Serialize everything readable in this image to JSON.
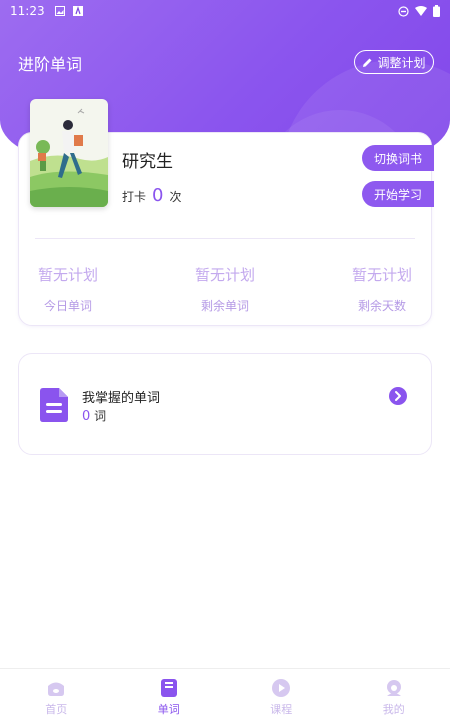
{
  "status_bar": {
    "time": "11:23"
  },
  "header": {
    "title": "进阶单词",
    "adjust_plan_label": "调整计划"
  },
  "book": {
    "name": "研究生",
    "checkin_prefix": "打卡",
    "checkin_count": "0",
    "checkin_suffix": "次",
    "switch_label": "切换词书",
    "start_label": "开始学习"
  },
  "stats": [
    {
      "value": "暂无计划",
      "label": "今日单词"
    },
    {
      "value": "暂无计划",
      "label": "剩余单词"
    },
    {
      "value": "暂无计划",
      "label": "剩余天数"
    }
  ],
  "mastered": {
    "title": "我掌握的单词",
    "count": "0",
    "unit": "词"
  },
  "bottom_nav": [
    {
      "label": "首页",
      "icon": "home-icon"
    },
    {
      "label": "单词",
      "icon": "book-icon"
    },
    {
      "label": "课程",
      "icon": "play-icon"
    },
    {
      "label": "我的",
      "icon": "profile-icon"
    }
  ],
  "colors": {
    "accent": "#8a54ee",
    "muted": "#c3a9ee"
  }
}
